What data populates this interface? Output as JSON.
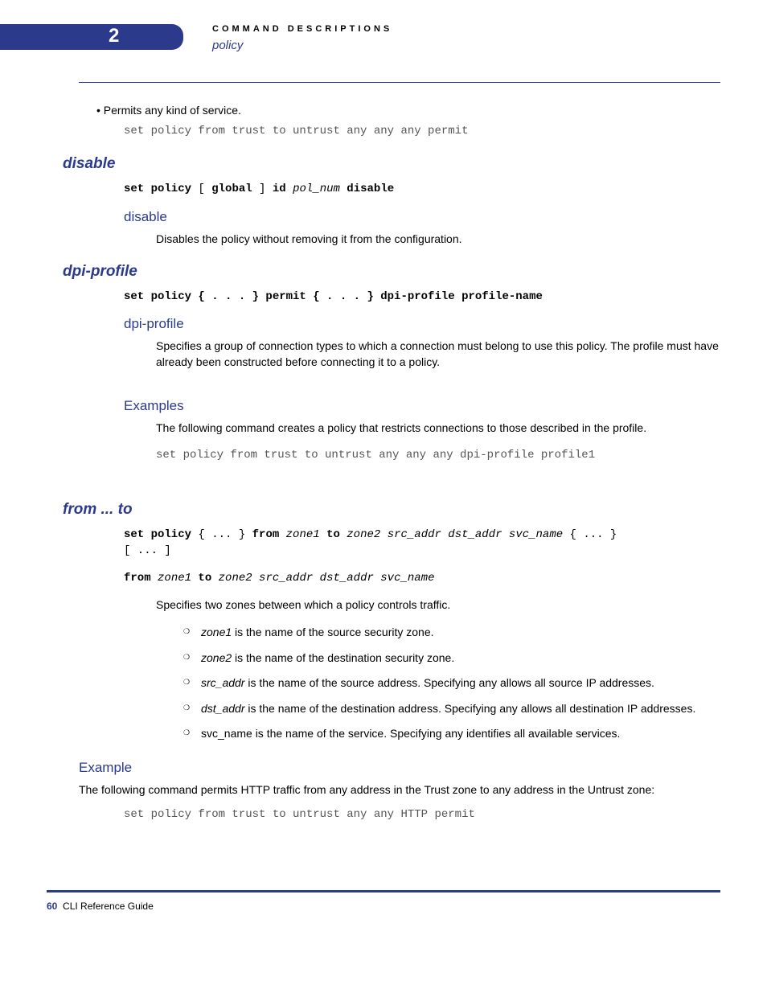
{
  "header": {
    "chapter_number": "2",
    "title": "COMMAND DESCRIPTIONS",
    "subtitle": "policy"
  },
  "intro": {
    "bullet": "Permits any kind of service.",
    "code": "set policy from trust to untrust any any any permit"
  },
  "disable": {
    "heading": "disable",
    "syntax_parts": {
      "p1": "set policy",
      "p2": " [ ",
      "p3": "global",
      "p4": " ] ",
      "p5": "id ",
      "p6": "pol_num",
      "p7": " disable"
    },
    "sub_heading": "disable",
    "desc": "Disables the policy without removing it from the configuration."
  },
  "dpi": {
    "heading": "dpi-profile",
    "syntax_parts": {
      "p1": "set policy { . . . } permit { . . . } dpi-profile profile-name"
    },
    "sub_heading": "dpi-profile",
    "desc": "Specifies a group of connection types to which a connection must belong to use this policy. The profile must have already been constructed before connecting it to a policy.",
    "examples_heading": "Examples",
    "examples_text": "The following command creates a policy that restricts connections to those described in the profile.",
    "examples_code": "set policy from trust to untrust any any any dpi-profile profile1"
  },
  "fromto": {
    "heading": "from ... to",
    "syntax1": {
      "p1": "set policy",
      "p2": " { ... } ",
      "p3": "from ",
      "p4": "zone1",
      "p5": " to ",
      "p6": "zone2 src_addr dst_addr svc_name",
      "p7": " { ... }\n[ ... ]"
    },
    "syntax2": {
      "p1": "from ",
      "p2": "zone1",
      "p3": " to ",
      "p4": "zone2 src_addr dst_addr svc_name"
    },
    "desc": "Specifies two zones between which a policy controls traffic.",
    "items": [
      {
        "term": "zone1",
        "rest": " is the name of the source security zone."
      },
      {
        "term": "zone2",
        "rest": " is the name of the destination security zone."
      },
      {
        "term": "src_addr",
        "rest": " is the name of the source address. Specifying any allows all source IP addresses."
      },
      {
        "term": "dst_addr",
        "rest": " is the name of the destination address. Specifying any allows all destination IP addresses."
      },
      {
        "term": "",
        "rest": "svc_name is the name of the service. Specifying any identifies all available services."
      }
    ],
    "example_heading": "Example",
    "example_text": "The following command permits HTTP traffic from any address in the Trust zone to any address in the Untrust zone:",
    "example_code": "set policy from trust to untrust any any HTTP permit"
  },
  "footer": {
    "page": "60",
    "label": "CLI Reference Guide"
  }
}
